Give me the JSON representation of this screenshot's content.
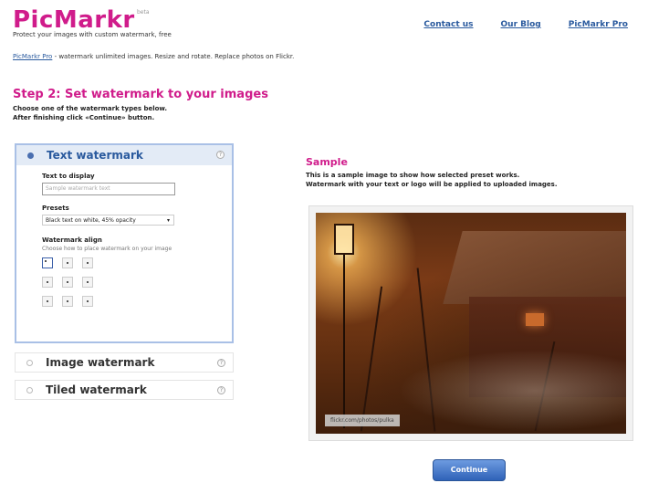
{
  "header": {
    "logo_text": "PicMarkr",
    "logo_beta": "beta",
    "tagline": "Protect your images with custom watermark, free",
    "nav": [
      "Contact us",
      "Our Blog",
      "PicMarkr Pro"
    ]
  },
  "promo": {
    "link": "PicMarkr Pro",
    "text": " - watermark unlimited images. Resize and rotate. Replace photos on Flickr."
  },
  "step": {
    "title": "Step 2: Set watermark to your images",
    "note_line1": "Choose one of the watermark types below.",
    "note_line2": "After finishing click «Continue» button."
  },
  "watermark_types": {
    "text": {
      "title": "Text watermark",
      "text_label": "Text to display",
      "text_placeholder": "Sample watermark text",
      "presets_label": "Presets",
      "preset_selected": "Black text on white, 45% opacity",
      "align_label": "Watermark align",
      "align_hint": "Choose how to place watermark on your image",
      "selected_cell": 0
    },
    "image": {
      "title": "Image watermark"
    },
    "tiled": {
      "title": "Tiled watermark"
    }
  },
  "sample": {
    "title": "Sample",
    "desc_line1": "This is a sample image to show how selected preset works.",
    "desc_line2": "Watermark with your text or logo will be applied to uploaded images.",
    "credit": "flickr.com/photos/pulka"
  },
  "buttons": {
    "continue": "Continue"
  },
  "colors": {
    "brand": "#d01c8b",
    "link": "#2a5a9e",
    "button": "#2f62b8"
  }
}
